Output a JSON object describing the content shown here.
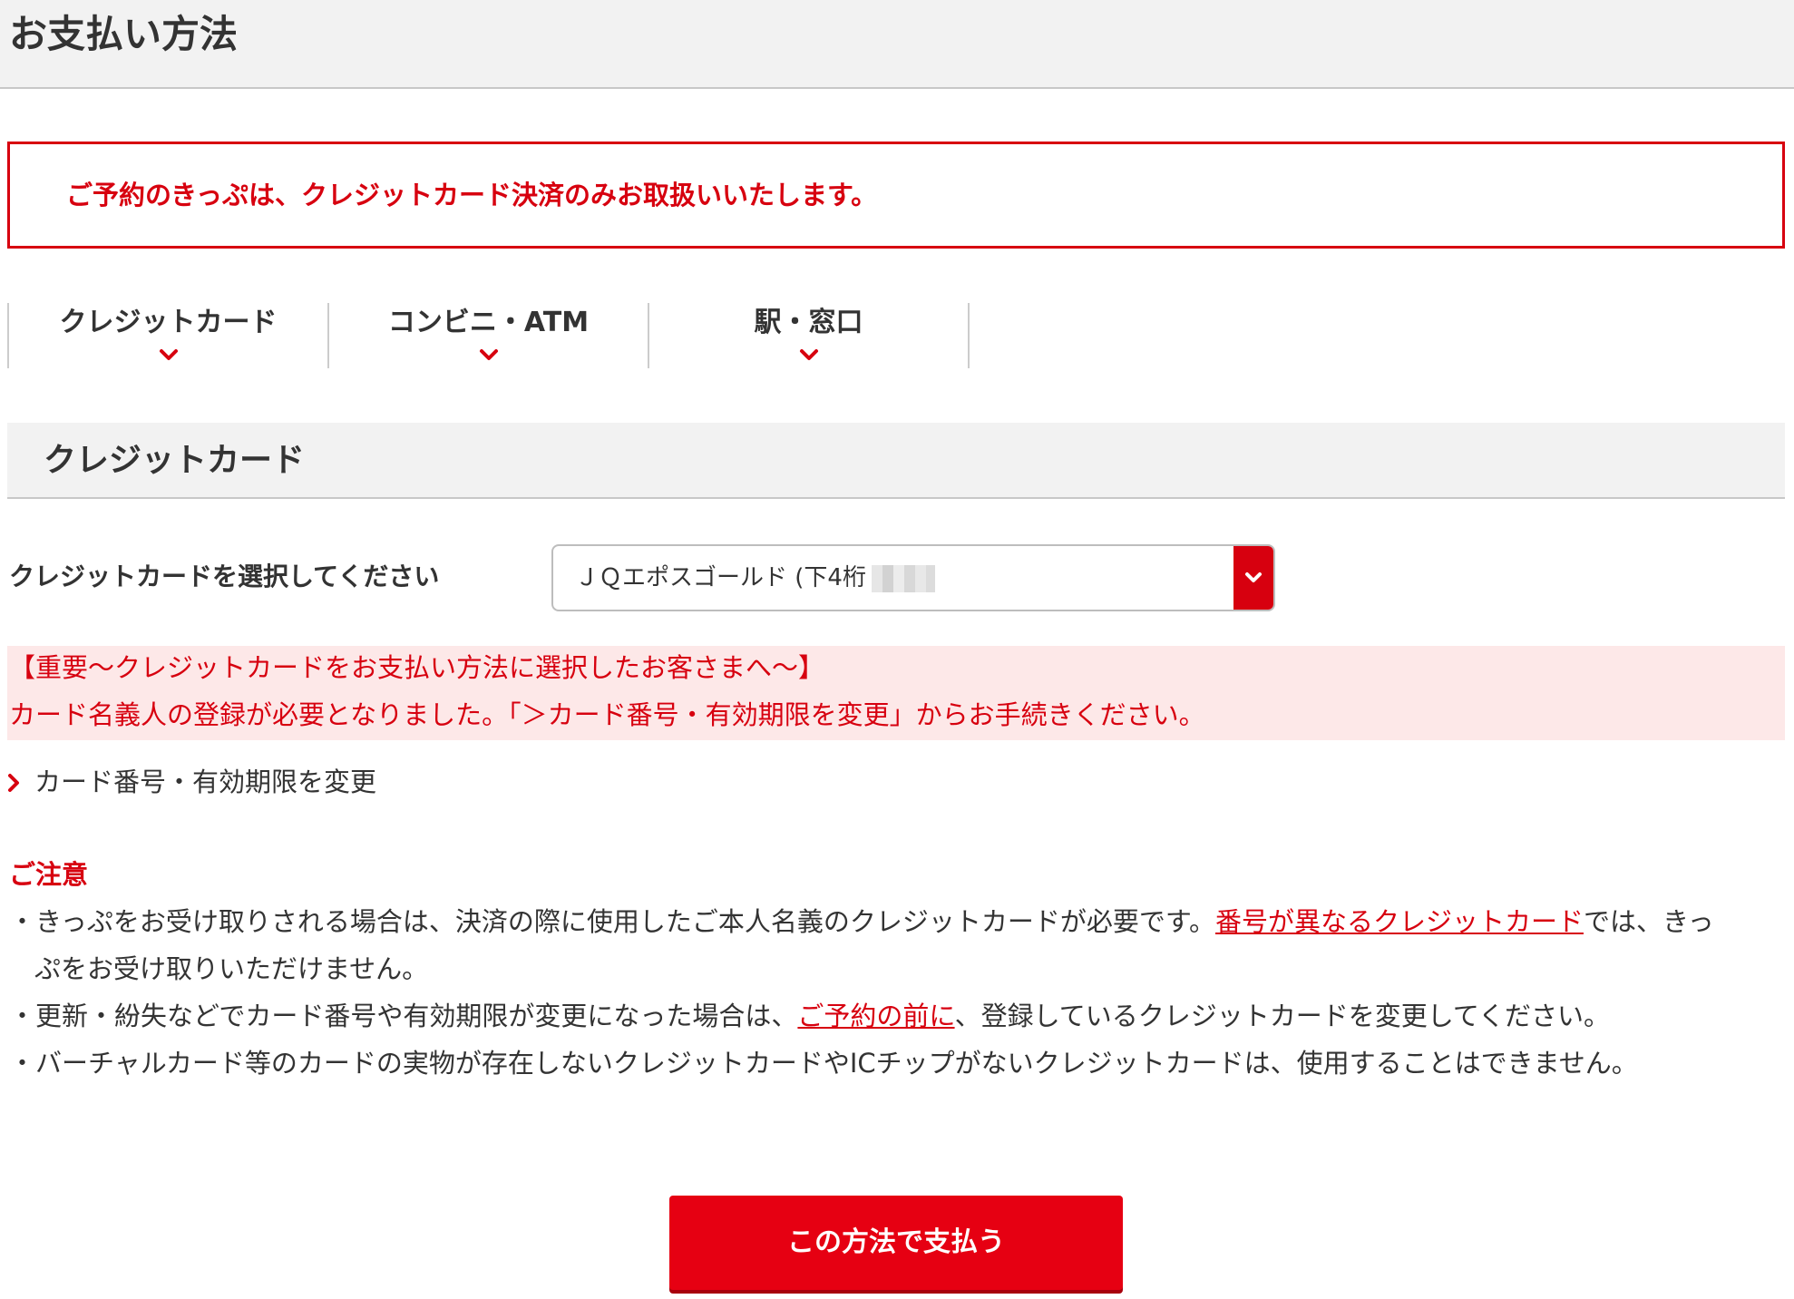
{
  "page": {
    "title": "お支払い方法"
  },
  "notice": {
    "text": "ご予約のきっぷは、クレジットカード決済のみお取扱いいたします。"
  },
  "method_tabs": [
    {
      "label": "クレジットカード"
    },
    {
      "label": "コンビニ・ATM"
    },
    {
      "label": "駅・窓口"
    }
  ],
  "credit_section": {
    "title": "クレジットカード",
    "select_label": "クレジットカードを選択してください",
    "selected_card": "ＪＱエポスゴールド (下4桁"
  },
  "important": {
    "line1": "【重要～クレジットカードをお支払い方法に選択したお客さまへ～】",
    "line2": "カード名義人の登録が必要となりました。「＞カード番号・有効期限を変更」からお手続きください。"
  },
  "change_card_link": {
    "label": "カード番号・有効期限を変更"
  },
  "caution": {
    "heading": "ご注意",
    "item1_before": "・きっぷをお受け取りされる場合は、決済の際に使用したご本人名義のクレジットカードが必要です。",
    "item1_link": "番号が異なるクレジットカード",
    "item1_after": "では、きっ",
    "item1_cont": "ぷをお受け取りいただけません。",
    "item2_before": "・更新・紛失などでカード番号や有効期限が変更になった場合は、",
    "item2_link": "ご予約の前に",
    "item2_after": "、登録しているクレジットカードを変更してください。",
    "item3": "・バーチャルカード等のカードの実物が存在しないクレジットカードやICチップがないクレジットカードは、使用することはできません。"
  },
  "pay_button": {
    "label": "この方法で支払う"
  },
  "colors": {
    "accent": "#d7000f",
    "important_bg": "#fde8e8",
    "header_bg": "#f2f2f2"
  }
}
